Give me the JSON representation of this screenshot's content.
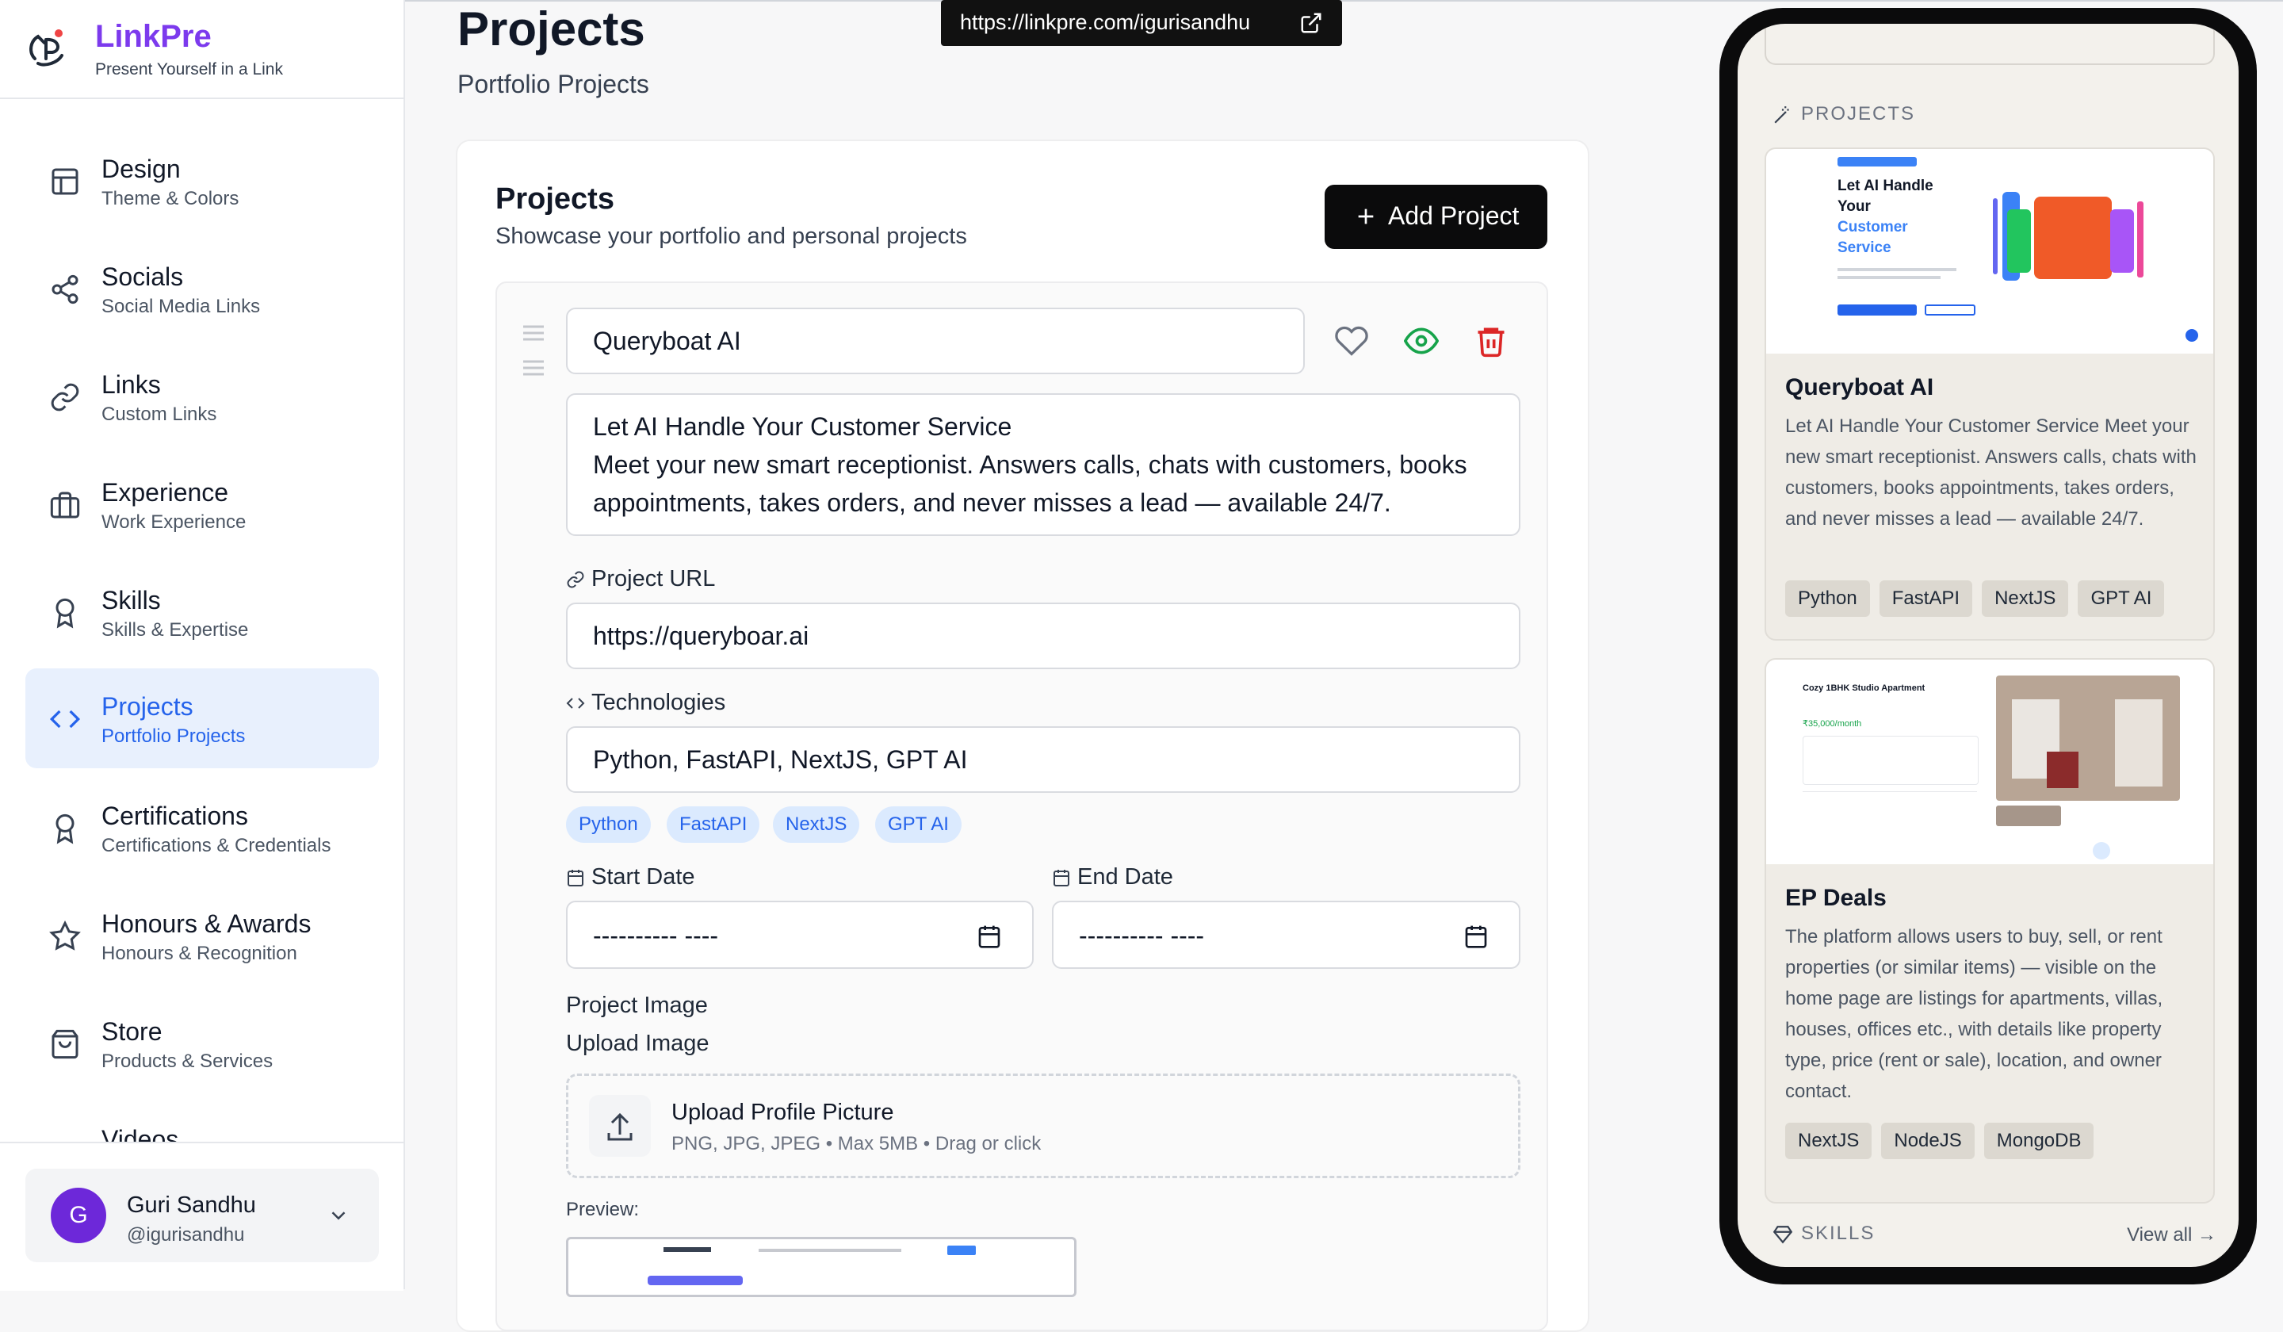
{
  "brand": {
    "name": "LinkPre",
    "tagline": "Present Yourself in a Link"
  },
  "sidebar": {
    "items": [
      {
        "title": "Design",
        "subtitle": "Theme & Colors",
        "icon": "layout-icon"
      },
      {
        "title": "Socials",
        "subtitle": "Social Media Links",
        "icon": "share-icon"
      },
      {
        "title": "Links",
        "subtitle": "Custom Links",
        "icon": "link-icon"
      },
      {
        "title": "Experience",
        "subtitle": "Work Experience",
        "icon": "briefcase-icon"
      },
      {
        "title": "Skills",
        "subtitle": "Skills & Expertise",
        "icon": "award-icon"
      },
      {
        "title": "Projects",
        "subtitle": "Portfolio Projects",
        "icon": "code-icon",
        "active": true
      },
      {
        "title": "Certifications",
        "subtitle": "Certifications & Credentials",
        "icon": "award-icon"
      },
      {
        "title": "Honours & Awards",
        "subtitle": "Honours & Recognition",
        "icon": "star-icon"
      },
      {
        "title": "Store",
        "subtitle": "Products & Services",
        "icon": "bag-icon"
      },
      {
        "title": "Videos",
        "subtitle": "",
        "icon": "video-icon"
      }
    ]
  },
  "user": {
    "initial": "G",
    "name": "Guri Sandhu",
    "handle": "@igurisandhu"
  },
  "header": {
    "title": "Projects",
    "subtitle": "Portfolio Projects",
    "public_url": "https://linkpre.com/igurisandhu"
  },
  "projects_card": {
    "title": "Projects",
    "subtitle": "Showcase your portfolio and personal projects",
    "add_button": "Add Project",
    "item": {
      "name": "Queryboat AI",
      "description_line1": "Let AI Handle Your Customer Service",
      "description_line2": "Meet your new smart receptionist. Answers calls, chats with customers, books",
      "description_line3": "appointments, takes orders, and never misses a lead — available 24/7.",
      "url_label": "Project URL",
      "url_value": "https://queryboar.ai",
      "tech_label": "Technologies",
      "tech_value": "Python, FastAPI, NextJS, GPT AI",
      "tags": [
        "Python",
        "FastAPI",
        "NextJS",
        "GPT AI"
      ],
      "start_label": "Start Date",
      "start_value": "---------- ----",
      "end_label": "End Date",
      "end_value": "---------- ----",
      "image_label": "Project Image",
      "upload_label": "Upload Image",
      "upload_title": "Upload Profile Picture",
      "upload_hint": "PNG, JPG, JPEG • Max 5MB • Drag or click",
      "preview_label": "Preview:"
    }
  },
  "phone_preview": {
    "projects_heading": "PROJECTS",
    "cards": [
      {
        "title": "Queryboat AI",
        "desc": "Let AI Handle Your Customer Service Meet your new smart receptionist. Answers calls, chats with customers, books appointments, takes orders, and never misses a lead — available 24/7.",
        "tags": [
          "Python",
          "FastAPI",
          "NextJS",
          "GPT AI"
        ],
        "hero_line1": "Let AI Handle",
        "hero_line2": "Your",
        "hero_line3": "Customer",
        "hero_line4": "Service"
      },
      {
        "title": "EP Deals",
        "desc": "The platform allows users to buy, sell, or rent properties (or similar items) — visible on the home page are listings for apartments, villas, houses, offices etc., with details like property type, price (rent or sale), location, and owner contact.",
        "tags": [
          "NextJS",
          "NodeJS",
          "MongoDB"
        ],
        "listing_title": "Cozy 1BHK Studio Apartment",
        "listing_price": "₹35,000/month"
      }
    ],
    "skills_heading": "SKILLS",
    "view_all": "View all →"
  },
  "colors": {
    "brand": "#7c3aed",
    "active": "#2563eb",
    "delete": "#dc2626",
    "visible": "#16a34a"
  }
}
